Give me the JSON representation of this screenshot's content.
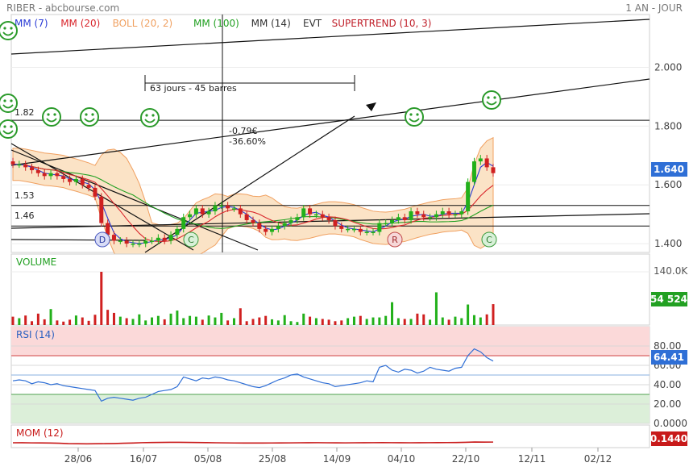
{
  "header": {
    "title": "RIBER - abcbourse.com",
    "period": "1 AN - JOUR"
  },
  "legend": {
    "items": [
      {
        "label": "MM (7)",
        "color": "#2a3bd6"
      },
      {
        "label": "MM (20)",
        "color": "#d9262c"
      },
      {
        "label": "BOLL (20, 2)",
        "color": "#f0a060"
      },
      {
        "label": "MM (100)",
        "color": "#22a022"
      },
      {
        "label": "MM (14)",
        "color": "#333333"
      },
      {
        "label": "EVT",
        "color": "#333333"
      },
      {
        "label": "SUPERTREND (10, 3)",
        "color": "#c0202a"
      }
    ]
  },
  "annotations": {
    "measure_label": "63 jours - 45 barres",
    "change_value": "-0.79€",
    "change_pct": "-36.60%",
    "level_182": "1.82",
    "level_153": "1.53",
    "level_146": "1.46",
    "event_markers": [
      "D",
      "C",
      "R",
      "C"
    ]
  },
  "colors": {
    "up_candle": "#22b01a",
    "down_candle": "#d02020",
    "boll_fill": "#fbe3c6",
    "price_badge": "#2f6fd6",
    "volume_badge": "#22a022",
    "rsi_badge": "#2f6fd6",
    "mom_badge": "#c81a1a",
    "rsi_upper_zone": "#fbd9d9",
    "rsi_lower_zone": "#dcefd9"
  },
  "badges": {
    "price": "1.640",
    "volume": "54 524",
    "rsi": "64.41",
    "mom": "0.1440"
  },
  "panels": {
    "volume_title": "VOLUME",
    "rsi_title": "RSI (14)",
    "mom_title": "MOM (12)"
  },
  "chart_data": [
    {
      "type": "candlestick",
      "title": "RIBER - abcbourse.com",
      "period": "1 AN - JOUR",
      "ylim": [
        1.37,
        2.18
      ],
      "y_ticks": [
        "2.000",
        "1.800",
        "1.600",
        "1.400"
      ],
      "x_ticks": [
        "28/06",
        "16/07",
        "05/08",
        "25/08",
        "14/09",
        "04/10",
        "22/10",
        "12/11",
        "02/12"
      ],
      "last_price": 1.64,
      "close_series": [
        1.67,
        1.67,
        1.66,
        1.65,
        1.64,
        1.63,
        1.64,
        1.63,
        1.62,
        1.61,
        1.62,
        1.6,
        1.59,
        1.56,
        1.47,
        1.43,
        1.41,
        1.41,
        1.4,
        1.4,
        1.4,
        1.41,
        1.41,
        1.42,
        1.41,
        1.43,
        1.45,
        1.49,
        1.5,
        1.52,
        1.5,
        1.51,
        1.53,
        1.53,
        1.52,
        1.52,
        1.5,
        1.48,
        1.47,
        1.45,
        1.44,
        1.45,
        1.46,
        1.47,
        1.48,
        1.49,
        1.52,
        1.5,
        1.5,
        1.49,
        1.48,
        1.46,
        1.45,
        1.45,
        1.45,
        1.44,
        1.44,
        1.44,
        1.47,
        1.47,
        1.48,
        1.49,
        1.48,
        1.51,
        1.5,
        1.49,
        1.49,
        1.5,
        1.51,
        1.5,
        1.5,
        1.51,
        1.61,
        1.68,
        1.69,
        1.66,
        1.64
      ],
      "horizontal_levels": [
        1.82,
        1.53,
        1.46
      ]
    },
    {
      "type": "bar",
      "title": "VOLUME",
      "y_ticks": [
        "140.0K"
      ],
      "last_value": 54524,
      "values_k": [
        22,
        18,
        25,
        10,
        30,
        15,
        42,
        12,
        9,
        14,
        25,
        20,
        11,
        27,
        140,
        40,
        32,
        22,
        18,
        16,
        28,
        12,
        20,
        24,
        15,
        30,
        38,
        18,
        24,
        22,
        14,
        25,
        20,
        32,
        12,
        18,
        44,
        10,
        16,
        20,
        24,
        15,
        12,
        26,
        10,
        8,
        30,
        22,
        18,
        16,
        14,
        10,
        12,
        18,
        22,
        24,
        16,
        20,
        20,
        24,
        60,
        18,
        16,
        16,
        30,
        28,
        14,
        86,
        20,
        14,
        22,
        18,
        54,
        26,
        20,
        28,
        55
      ]
    },
    {
      "type": "line",
      "title": "RSI (14)",
      "ylim": [
        0,
        100
      ],
      "y_ticks": [
        "80.00",
        "60.00",
        "40.00",
        "20.00",
        "0.0000"
      ],
      "last_value": 64.41,
      "values": [
        44,
        45,
        44,
        41,
        43,
        42,
        40,
        41,
        39,
        38,
        37,
        36,
        35,
        34,
        23,
        26,
        27,
        26,
        25,
        24,
        26,
        27,
        30,
        33,
        34,
        35,
        38,
        48,
        46,
        44,
        47,
        46,
        48,
        47,
        45,
        44,
        42,
        40,
        38,
        37,
        39,
        42,
        45,
        47,
        50,
        51,
        48,
        46,
        44,
        42,
        41,
        38,
        39,
        40,
        41,
        42,
        44,
        43,
        58,
        60,
        55,
        53,
        56,
        55,
        52,
        54,
        58,
        56,
        55,
        54,
        57,
        58,
        70,
        77,
        74,
        68,
        64.41
      ]
    },
    {
      "type": "line",
      "title": "MOM (12)",
      "last_value": 0.144,
      "values": [
        0.0,
        0.01,
        -0.02,
        -0.03,
        -0.05,
        -0.1,
        -0.18,
        -0.2,
        -0.22,
        -0.2,
        -0.18,
        -0.15,
        -0.1,
        -0.05,
        0.02,
        0.05,
        0.08,
        0.1,
        0.09,
        0.08,
        0.06,
        0.03,
        0.0,
        -0.02,
        -0.04,
        -0.05,
        -0.06,
        -0.05,
        -0.04,
        -0.03,
        -0.02,
        0.0,
        0.01,
        0.02,
        0.0,
        -0.01,
        -0.02,
        0.0,
        0.01,
        0.02,
        0.03,
        0.02,
        0.01,
        0.0,
        0.01,
        0.02,
        0.03,
        0.04,
        0.05,
        0.1,
        0.15,
        0.14,
        0.144
      ]
    }
  ]
}
